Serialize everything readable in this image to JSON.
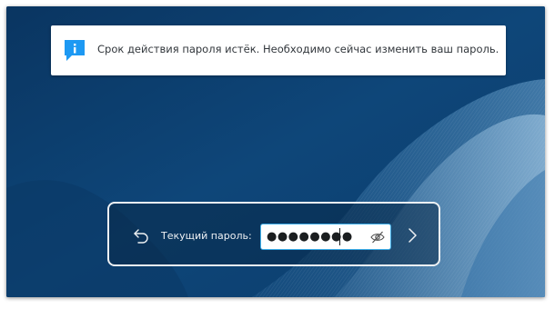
{
  "notice": {
    "icon": "info-bubble-icon",
    "text": "Срок действия пароля истёк. Необходимо сейчас изменить ваш пароль."
  },
  "login": {
    "field_label": "Текущий пароль:",
    "password_masked": "●●●●●●●●",
    "back_icon": "undo-arrow-icon",
    "reveal_icon": "eye-slash-icon",
    "next_icon": "chevron-right-icon"
  },
  "colors": {
    "background": "#0d4577",
    "panel_border": "#eef1f4",
    "focus_border": "#3daee9",
    "info_icon": "#1d99f3"
  }
}
